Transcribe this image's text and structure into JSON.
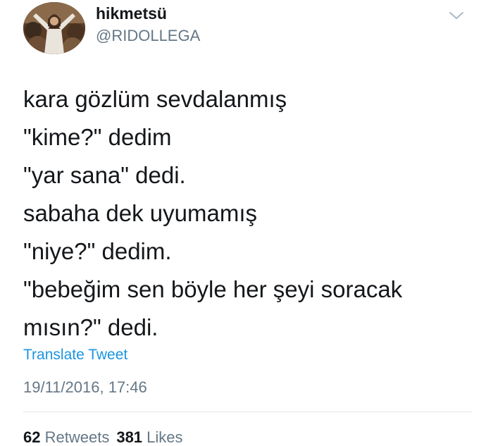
{
  "author": {
    "display_name": "hikmetsü",
    "handle": "@RIDOLLEGA",
    "avatar": "avatar-image"
  },
  "menu_icon": "chevron-down-icon",
  "tweet": {
    "lines": [
      "kara gözlüm sevdalanmış",
      "\"kime?\" dedim",
      "\"yar sana\" dedi.",
      "sabaha dek uyumamış",
      "\"niye?\" dedim.",
      "\"bebeğim sen böyle her şeyi soracak",
      "mısın?\" dedi."
    ],
    "translate_label": "Translate Tweet",
    "timestamp": "19/11/2016, 17:46"
  },
  "stats": {
    "retweets_count": "62",
    "retweets_label": "Retweets",
    "likes_count": "381",
    "likes_label": "Likes"
  },
  "colors": {
    "text": "#14171a",
    "secondary": "#657786",
    "link": "#1b95e0",
    "divider": "#e1e8ed"
  }
}
